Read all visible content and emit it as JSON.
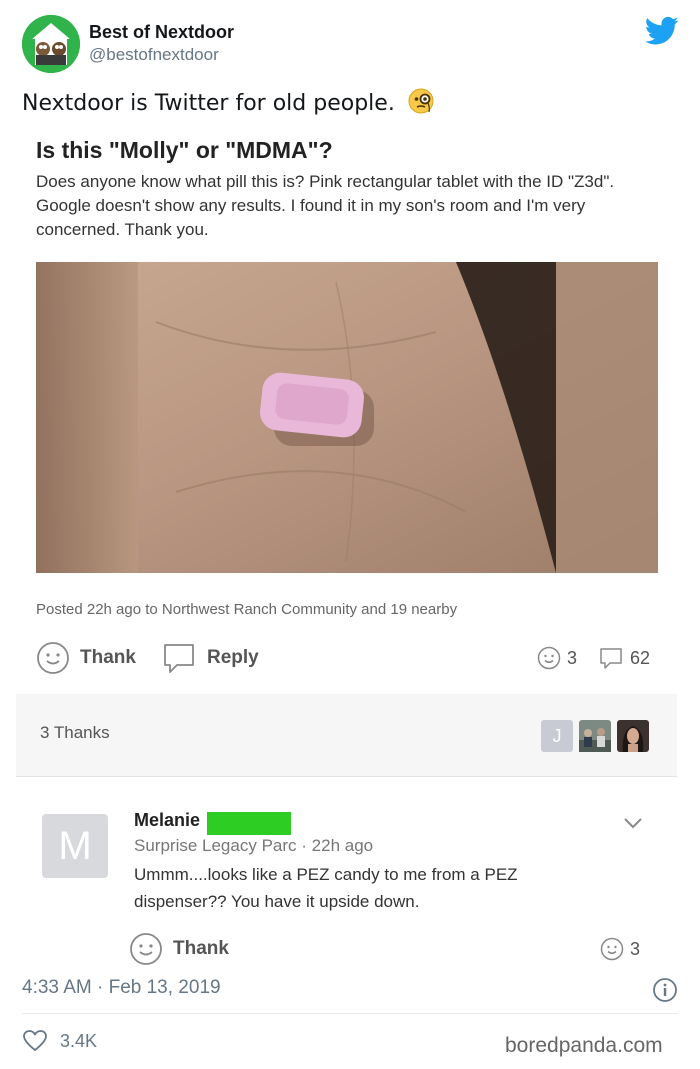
{
  "tweet": {
    "display_name": "Best of Nextdoor",
    "handle": "@bestofnextdoor",
    "text": "Nextdoor is Twitter for old people.",
    "emoji_icon": "face-with-monocle-icon",
    "timestamp": "4:33 AM · Feb 13, 2019",
    "likes": "3.4K"
  },
  "post": {
    "title": "Is this \"Molly\" or \"MDMA\"?",
    "body": "Does anyone know what pill this is?  Pink rectangular tablet with the ID \"Z3d\". Google doesn't show any results. I found it in my son's room and I'm very concerned. Thank you.",
    "posted": "Posted 22h ago to Northwest Ranch Community and 19 nearby",
    "thank_label": "Thank",
    "reply_label": "Reply",
    "thanks_count": "3",
    "replies_count": "62",
    "thanks_summary": "3 Thanks",
    "thanker_initial": "J"
  },
  "comment": {
    "avatar_initial": "M",
    "name": "Melanie",
    "neighborhood": "Surprise Legacy Parc",
    "time": "22h ago",
    "body": "Ummm....looks like a PEZ candy to me from a PEZ dispenser?? You have it upside down.",
    "thank_label": "Thank",
    "thanks_count": "3"
  },
  "watermark": "boredpanda.com",
  "colors": {
    "twitter_blue": "#1da1f2",
    "nextdoor_green": "#2fb34a",
    "censor_green": "#2dcd24",
    "muted_text": "#657786"
  }
}
